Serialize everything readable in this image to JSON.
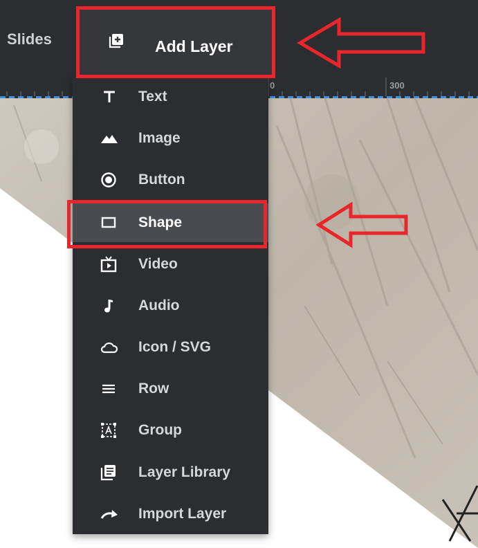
{
  "toolbar": {
    "slides_label": "Slides",
    "add_layer_label": "Add Layer",
    "add_layer_icon": "add-layer-icon"
  },
  "ruler": {
    "tick_labels": [
      "0",
      "300"
    ]
  },
  "menu": {
    "items": [
      {
        "label": "Text",
        "icon": "text-icon"
      },
      {
        "label": "Image",
        "icon": "image-icon"
      },
      {
        "label": "Button",
        "icon": "button-icon"
      },
      {
        "label": "Shape",
        "icon": "shape-icon",
        "active": true
      },
      {
        "label": "Video",
        "icon": "video-icon"
      },
      {
        "label": "Audio",
        "icon": "audio-icon"
      },
      {
        "label": "Icon / SVG",
        "icon": "cloud-icon"
      },
      {
        "label": "Row",
        "icon": "row-icon"
      },
      {
        "label": "Group",
        "icon": "group-icon"
      },
      {
        "label": "Layer Library",
        "icon": "layer-library-icon"
      },
      {
        "label": "Import Layer",
        "icon": "import-layer-icon"
      }
    ]
  },
  "colors": {
    "toolbar_bg": "#2c2d30",
    "menu_bg": "#2c2d30",
    "active_item_bg": "#494b50",
    "highlight_red": "#e8262b",
    "ruler_dash_blue": "#3a8ee6"
  }
}
